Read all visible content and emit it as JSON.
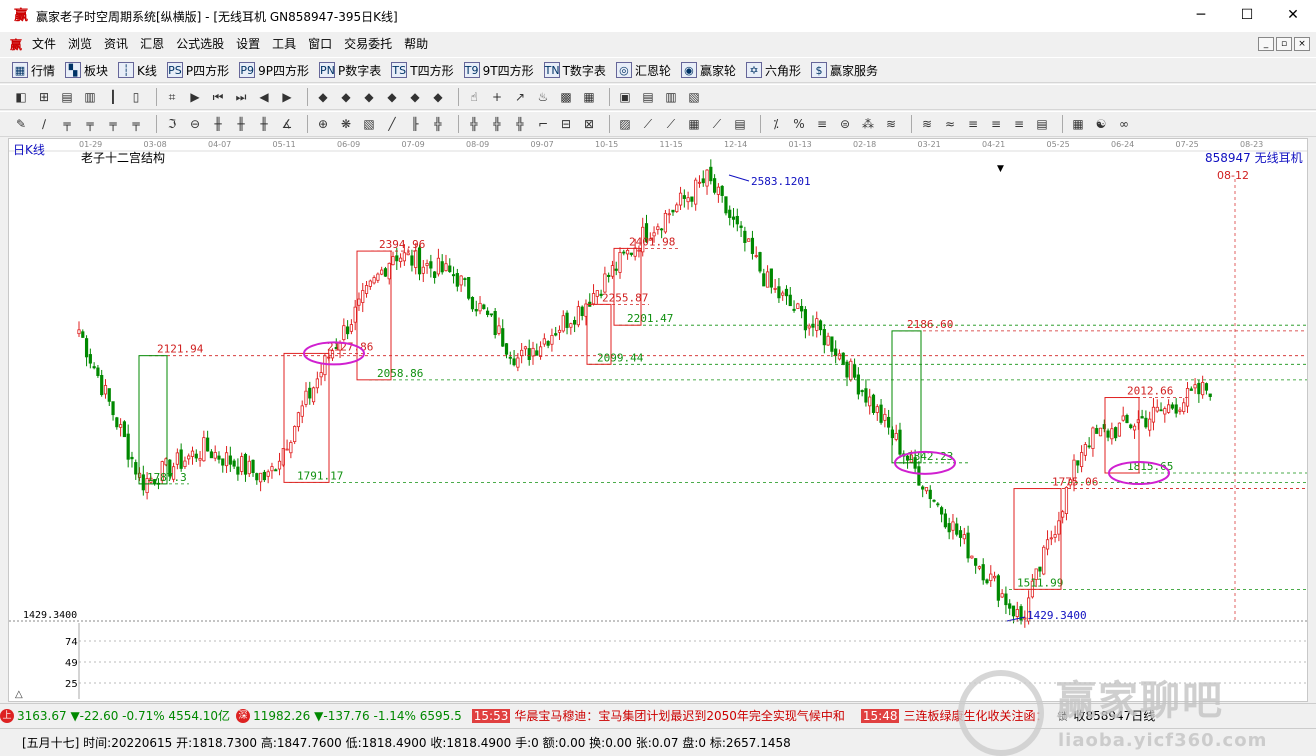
{
  "window": {
    "title": "赢家老子时空周期系统[纵横版] - [无线耳机  GN858947-395日K线]",
    "minimize": "─",
    "maximize": "☐",
    "close": "✕"
  },
  "menu": {
    "logo": "赢",
    "items": [
      "文件",
      "浏览",
      "资讯",
      "汇恩",
      "公式选股",
      "设置",
      "工具",
      "窗口",
      "交易委托",
      "帮助"
    ],
    "mdi_buttons": [
      "_",
      "▫",
      "×"
    ]
  },
  "toolbar1": {
    "items": [
      {
        "icon": "grid-icon",
        "glyph": "▦",
        "label": "行情"
      },
      {
        "icon": "blocks-icon",
        "glyph": "▚",
        "label": "板块"
      },
      {
        "icon": "kline-icon",
        "glyph": "┆",
        "label": "K线"
      },
      {
        "icon": "ps-icon",
        "glyph": "PS",
        "label": "P四方形"
      },
      {
        "icon": "p9-icon",
        "glyph": "P9",
        "label": "9P四方形"
      },
      {
        "icon": "pn-icon",
        "glyph": "PN",
        "label": "P数字表"
      },
      {
        "icon": "ts-icon",
        "glyph": "TS",
        "label": "T四方形"
      },
      {
        "icon": "t9-icon",
        "glyph": "T9",
        "label": "9T四方形"
      },
      {
        "icon": "tn-icon",
        "glyph": "TN",
        "label": "T数字表"
      },
      {
        "icon": "circle-icon",
        "glyph": "◎",
        "label": "汇恩轮"
      },
      {
        "icon": "big-icon",
        "glyph": "◉",
        "label": "赢家轮"
      },
      {
        "icon": "hexagon-icon",
        "glyph": "✡",
        "label": "六角形"
      },
      {
        "icon": "dollar-icon",
        "glyph": "$",
        "label": "赢家服务"
      }
    ]
  },
  "toolbar2": {
    "glyphs": [
      "◧",
      "⊞",
      "▤",
      "▥",
      "┃",
      "▯",
      "⌗",
      "▶",
      "⏮",
      "⏭",
      "◀",
      "▶",
      "◆",
      "◆",
      "◆",
      "◆",
      "◆",
      "◆",
      "☝",
      "+",
      "↗",
      "♨",
      "▩",
      "▦",
      "▣",
      "▤",
      "▥",
      "▧"
    ]
  },
  "toolbar3": {
    "glyphs": [
      "✎",
      "∕",
      "╤",
      "╤",
      "╤",
      "╤",
      "ℑ",
      "⊖",
      "╫",
      "╫",
      "╫",
      "∡",
      "⊕",
      "❋",
      "▧",
      "╱",
      "╟",
      "╬",
      "╬",
      "╬",
      "╬",
      "⌐",
      "⊟",
      "⊠",
      "▨",
      "⟋",
      "⟋",
      "▦",
      "⟋",
      "▤",
      "⁒",
      "%",
      "≡",
      "⊜",
      "⁂",
      "≋",
      "≋",
      "≈",
      "≡",
      "≡",
      "≡",
      "▤",
      "▦",
      "☯",
      "∞"
    ]
  },
  "chart": {
    "period_label": "日K线",
    "indicator_name": "老子十二宫结构",
    "stock_label": "858947 无线耳机",
    "cursor_date": "08-12",
    "dropdown_glyph": "▼",
    "low_axis_label": "1429.3400",
    "vol_labels": [
      "74",
      "49",
      "25"
    ],
    "scroll_glyph": "△",
    "dates": [
      "01-29",
      "03-08",
      "04-07",
      "05-11",
      "06-09",
      "07-09",
      "08-09",
      "09-07",
      "10-15",
      "11-15",
      "12-14",
      "01-13",
      "02-18",
      "03-21",
      "04-21",
      "05-25",
      "06-24",
      "07-25",
      "08-23"
    ],
    "colors": {
      "up": "#e02020",
      "down": "#008800",
      "red_level": "#d02020",
      "green_level": "#109010",
      "blue": "#1010c0",
      "magenta": "#d020d0"
    }
  },
  "chart_data": {
    "type": "candlestick",
    "title": "老子十二宫结构",
    "ylim": [
      1429.34,
      2583.1201
    ],
    "annotations": [
      {
        "label": "2583.1201",
        "kind": "high"
      },
      {
        "label": "1429.3400",
        "kind": "low"
      },
      {
        "label": "2121.94",
        "kind": "red-level"
      },
      {
        "label": "2127.86",
        "kind": "red-level"
      },
      {
        "label": "2394.96",
        "kind": "red-level"
      },
      {
        "label": "2401.98",
        "kind": "red-level"
      },
      {
        "label": "2255.87",
        "kind": "red-level"
      },
      {
        "label": "2186.60",
        "kind": "red-level"
      },
      {
        "label": "2012.66",
        "kind": "red-level"
      },
      {
        "label": "1775.06",
        "kind": "red-level"
      },
      {
        "label": "1787.3",
        "kind": "green-level"
      },
      {
        "label": "1791.17",
        "kind": "green-level"
      },
      {
        "label": "2058.86",
        "kind": "green-level"
      },
      {
        "label": "2099.44",
        "kind": "green-level"
      },
      {
        "label": "2201.47",
        "kind": "green-level"
      },
      {
        "label": "1842.23",
        "kind": "green-level"
      },
      {
        "label": "1815.65",
        "kind": "green-level"
      },
      {
        "label": "1511.99",
        "kind": "green-level"
      }
    ],
    "price_path": [
      [
        "01-29",
        2190
      ],
      [
        "03-08",
        1790
      ],
      [
        "04-07",
        1880
      ],
      [
        "05-11",
        1800
      ],
      [
        "06-09",
        2130
      ],
      [
        "07-09",
        2390
      ],
      [
        "08-09",
        2330
      ],
      [
        "09-07",
        2110
      ],
      [
        "10-15",
        2250
      ],
      [
        "11-15",
        2440
      ],
      [
        "12-14",
        2583
      ],
      [
        "01-13",
        2300
      ],
      [
        "02-18",
        2150
      ],
      [
        "03-21",
        1900
      ],
      [
        "04-21",
        1650
      ],
      [
        "05-25",
        1430
      ],
      [
        "06-24",
        1900
      ],
      [
        "07-25",
        1960
      ],
      [
        "08-12",
        2040
      ]
    ]
  },
  "infobar": {
    "idx1_icon": "上",
    "idx1": "3163.67 ▼-22.60 -0.71% 4554.10亿",
    "idx2_icon": "深",
    "idx2": "11982.26 ▼-137.76 -1.14% 6595.5",
    "news1_time": "15:53",
    "news1": "华晨宝马穆迪：宝马集团计划最迟到2050年完全实现气候中和",
    "news2_time": "15:48",
    "news2": "三连板绿康生化收关注函：",
    "lock_icon": "锁",
    "close_label": "收858947日线"
  },
  "status": {
    "text": "[五月十七] 时间:20220615 开:1818.7300 高:1847.7600 低:1818.4900 收:1818.4900 手:0 额:0.00 换:0.00 张:0.07 盘:0 标:2657.1458"
  },
  "watermark": {
    "title": "赢家聊吧",
    "url": "liaoba.yicf360.com",
    "ring": "财赢"
  }
}
